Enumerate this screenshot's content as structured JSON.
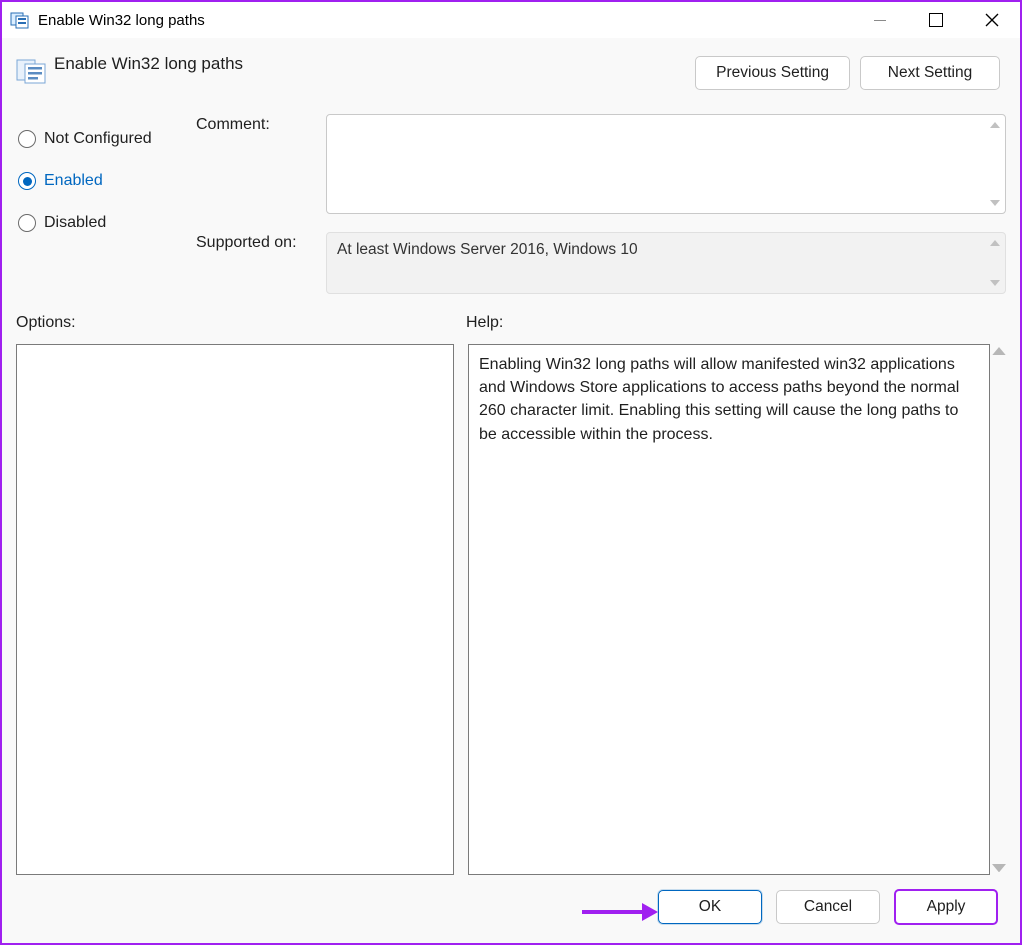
{
  "window": {
    "title": "Enable Win32 long paths"
  },
  "header": {
    "policy_title": "Enable Win32 long paths",
    "prev_button": "Previous Setting",
    "next_button": "Next Setting"
  },
  "radios": {
    "not_configured": "Not Configured",
    "enabled": "Enabled",
    "disabled": "Disabled",
    "selected": "enabled"
  },
  "fields": {
    "comment_label": "Comment:",
    "comment_value": "",
    "supported_label": "Supported on:",
    "supported_value": "At least Windows Server 2016, Windows 10"
  },
  "labels": {
    "options": "Options:",
    "help": "Help:"
  },
  "help_text": "Enabling Win32 long paths will allow manifested win32 applications and Windows Store applications to access paths beyond the normal 260 character limit.  Enabling this setting will cause the long paths to be accessible within the process.",
  "footer": {
    "ok": "OK",
    "cancel": "Cancel",
    "apply": "Apply"
  }
}
